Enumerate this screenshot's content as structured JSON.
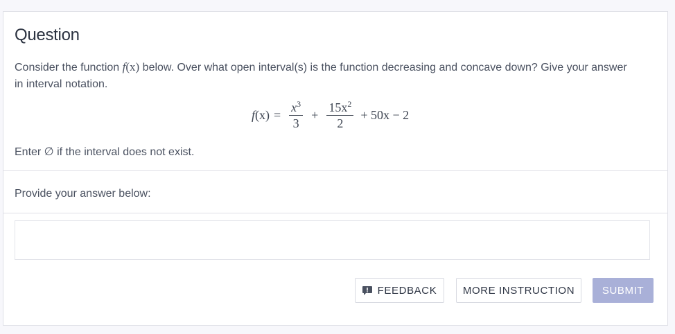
{
  "question": {
    "title": "Question",
    "prompt_before": "Consider the function ",
    "prompt_fx": "f",
    "prompt_paren": "(x)",
    "prompt_after": " below. Over what open interval(s) is the function decreasing and concave down? Give your answer in interval notation.",
    "formula": {
      "lhs_f": "f",
      "lhs_paren": "(x)",
      "equals": "=",
      "frac1_num": "x",
      "frac1_num_exp": "3",
      "frac1_den": "3",
      "plus1": "+",
      "frac2_num": "15x",
      "frac2_num_exp": "2",
      "frac2_den": "2",
      "tail": "+ 50x − 2"
    },
    "hint": "Enter ∅ if the interval does not exist."
  },
  "answer": {
    "label": "Provide your answer below:",
    "value": "",
    "placeholder": ""
  },
  "buttons": {
    "feedback": "FEEDBACK",
    "more_instruction": "MORE INSTRUCTION",
    "submit": "SUBMIT"
  },
  "icons": {
    "feedback": "feedback-icon"
  },
  "colors": {
    "submit_bg": "#a9b0d8",
    "feedback_icon": "#4a5160"
  }
}
